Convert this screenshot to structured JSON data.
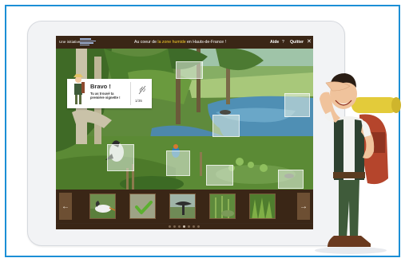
{
  "app": {
    "initiative_label": "Une initiative",
    "title_before": "Au coeur de ",
    "title_highlight": "la zone humide",
    "title_after": " en Hauts-de-France !",
    "help_label": "Aide",
    "help_icon": "?",
    "quit_label": "Quitter",
    "quit_icon": "✕"
  },
  "popup": {
    "title": "Bravo !",
    "message": "Tu as trouvé ta première vignette !",
    "count": "1/35",
    "icon": "leaf-icon"
  },
  "carousel": {
    "prev_icon": "←",
    "next_icon": "→",
    "thumbnails": [
      {
        "name": "heron-thumbnail",
        "state": "found"
      },
      {
        "name": "checked-thumbnail",
        "state": "validated"
      },
      {
        "name": "cormorant-thumbnail",
        "state": "hidden"
      },
      {
        "name": "reeds-thumbnail",
        "state": "hidden"
      },
      {
        "name": "grass-thumbnail",
        "state": "hidden"
      }
    ],
    "page_dots": 7,
    "active_dot": 3
  },
  "colors": {
    "frame_border": "#1c8fd6",
    "bar_background": "#3a2616",
    "title_highlight": "#f7cf2b",
    "check_green": "#5cb030"
  }
}
